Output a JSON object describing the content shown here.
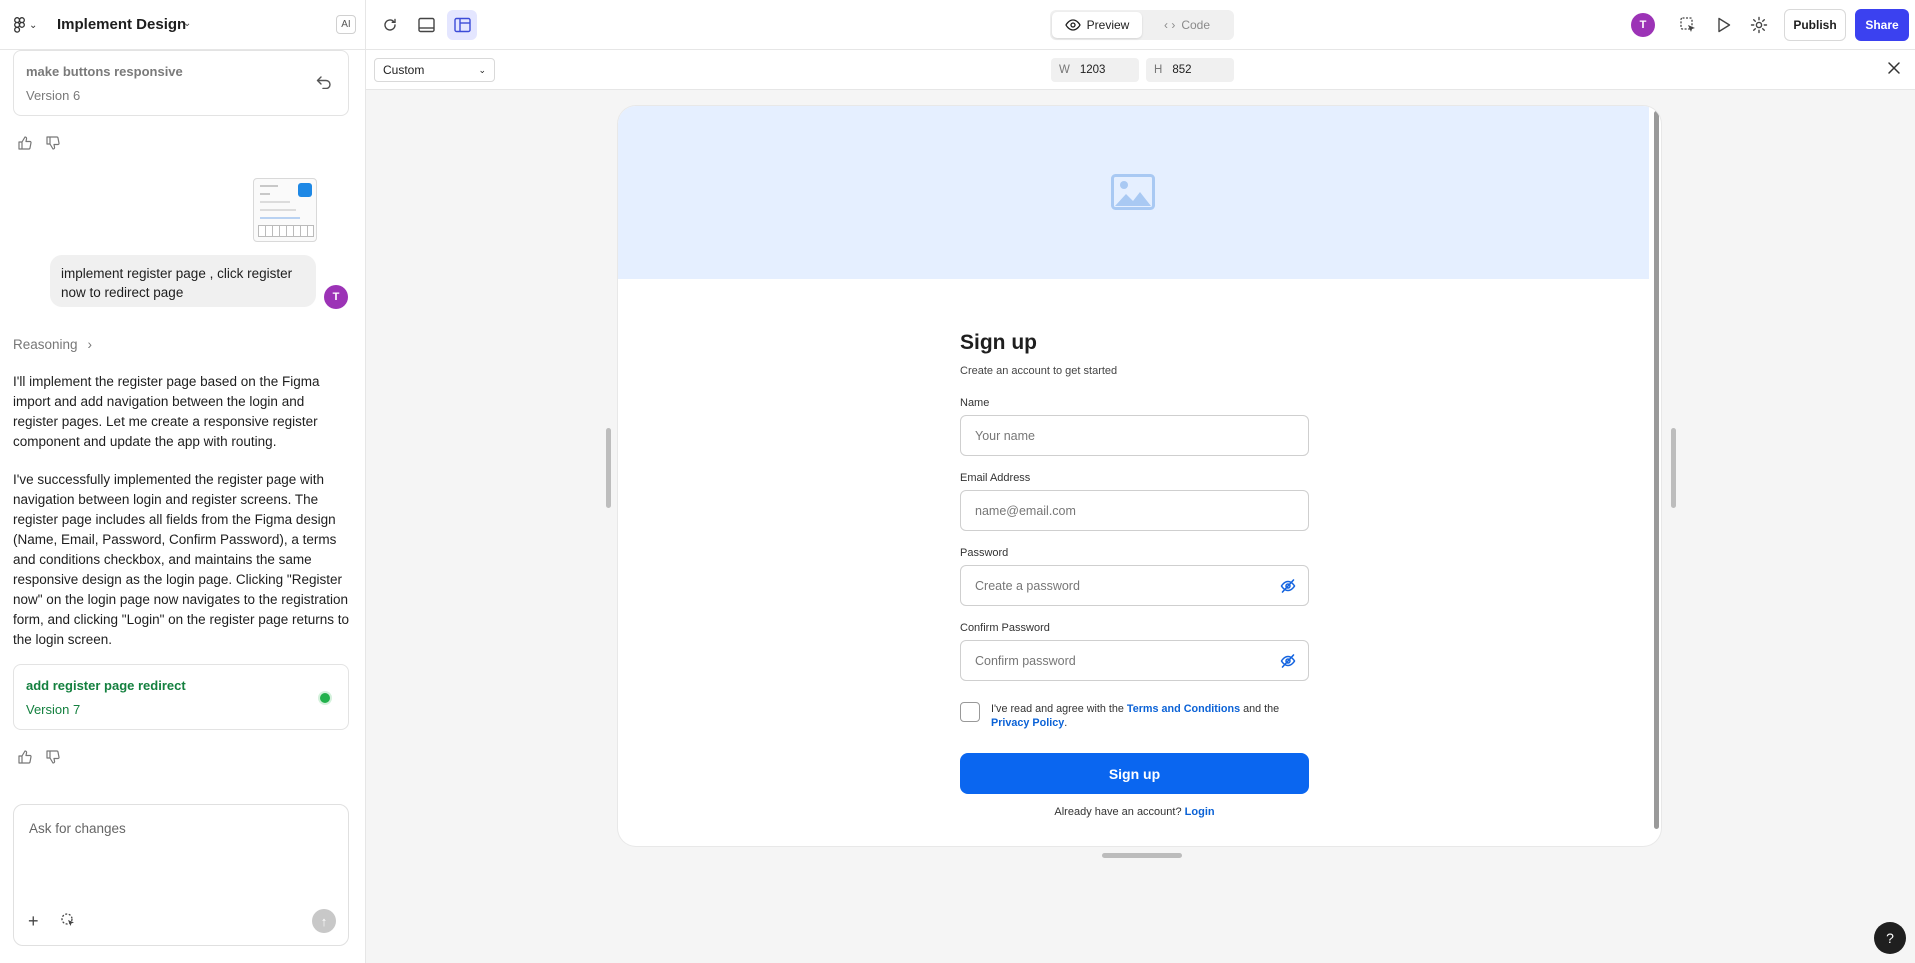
{
  "header": {
    "project_title": "Implement Design",
    "ai_badge": "AI",
    "preview_label": "Preview",
    "code_label": "Code",
    "user_initial": "T",
    "publish_label": "Publish",
    "share_label": "Share"
  },
  "chat": {
    "version_prev": {
      "title": "make buttons responsive",
      "version": "Version 6"
    },
    "user_message": "implement register page , click register now to redirect page",
    "user_initial": "T",
    "reasoning_label": "Reasoning",
    "assistant_para1": "I'll implement the register page based on the Figma import and add navigation between the login and register pages. Let me create a responsive register component and update the app with routing.",
    "assistant_para2": "I've successfully implemented the register page with navigation between login and register screens. The register page includes all fields from the Figma design (Name, Email, Password, Confirm Password), a terms and conditions checkbox, and maintains the same responsive design as the login page. Clicking \"Register now\" on the login page now navigates to the registration form, and clicking \"Login\" on the register page returns to the login screen.",
    "version_current": {
      "title": "add register page redirect",
      "version": "Version 7"
    },
    "input_placeholder": "Ask for changes"
  },
  "preview_toolbar": {
    "device_select": "Custom",
    "width_label": "W",
    "width_value": "1203",
    "height_label": "H",
    "height_value": "852"
  },
  "signup": {
    "title": "Sign up",
    "subtitle": "Create an account to get started",
    "name_label": "Name",
    "name_placeholder": "Your name",
    "email_label": "Email Address",
    "email_placeholder": "name@email.com",
    "password_label": "Password",
    "password_placeholder": "Create a password",
    "confirm_label": "Confirm Password",
    "confirm_placeholder": "Confirm password",
    "terms_prefix": "I've read and agree with the ",
    "terms_link": "Terms and Conditions",
    "terms_mid": " and the ",
    "privacy_link": "Privacy Policy",
    "terms_suffix": ".",
    "button_label": "Sign up",
    "already_text": "Already have an account? ",
    "login_link": "Login"
  },
  "help_label": "?"
}
